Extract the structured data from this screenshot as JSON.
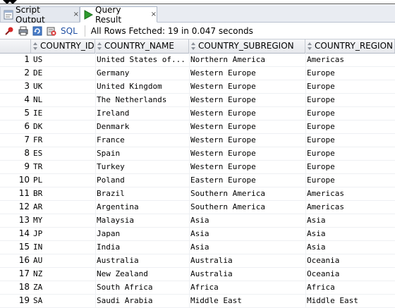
{
  "tabs": [
    {
      "label": "Script Output",
      "close": "×"
    },
    {
      "label": "Query Result",
      "close": "×"
    }
  ],
  "toolbar": {
    "icons": [
      "pin-icon",
      "print-icon",
      "refresh-icon",
      "export-icon"
    ],
    "sql_label": "SQL",
    "status": "All Rows Fetched: 19 in 0.047 seconds"
  },
  "grid": {
    "columns": [
      "COUNTRY_ID",
      "COUNTRY_NAME",
      "COUNTRY_SUBREGION",
      "COUNTRY_REGION"
    ],
    "rows": [
      {
        "n": "1",
        "id": "US",
        "name": "United States of...",
        "subregion": "Northern America",
        "region": "Americas"
      },
      {
        "n": "2",
        "id": "DE",
        "name": "Germany",
        "subregion": "Western Europe",
        "region": "Europe"
      },
      {
        "n": "3",
        "id": "UK",
        "name": "United Kingdom",
        "subregion": "Western Europe",
        "region": "Europe"
      },
      {
        "n": "4",
        "id": "NL",
        "name": "The Netherlands",
        "subregion": "Western Europe",
        "region": "Europe"
      },
      {
        "n": "5",
        "id": "IE",
        "name": "Ireland",
        "subregion": "Western Europe",
        "region": "Europe"
      },
      {
        "n": "6",
        "id": "DK",
        "name": "Denmark",
        "subregion": "Western Europe",
        "region": "Europe"
      },
      {
        "n": "7",
        "id": "FR",
        "name": "France",
        "subregion": "Western Europe",
        "region": "Europe"
      },
      {
        "n": "8",
        "id": "ES",
        "name": "Spain",
        "subregion": "Western Europe",
        "region": "Europe"
      },
      {
        "n": "9",
        "id": "TR",
        "name": "Turkey",
        "subregion": "Western Europe",
        "region": "Europe"
      },
      {
        "n": "10",
        "id": "PL",
        "name": "Poland",
        "subregion": "Eastern Europe",
        "region": "Europe"
      },
      {
        "n": "11",
        "id": "BR",
        "name": "Brazil",
        "subregion": "Southern America",
        "region": "Americas"
      },
      {
        "n": "12",
        "id": "AR",
        "name": "Argentina",
        "subregion": "Southern America",
        "region": "Americas"
      },
      {
        "n": "13",
        "id": "MY",
        "name": "Malaysia",
        "subregion": "Asia",
        "region": "Asia"
      },
      {
        "n": "14",
        "id": "JP",
        "name": "Japan",
        "subregion": "Asia",
        "region": "Asia"
      },
      {
        "n": "15",
        "id": "IN",
        "name": "India",
        "subregion": "Asia",
        "region": "Asia"
      },
      {
        "n": "16",
        "id": "AU",
        "name": "Australia",
        "subregion": "Australia",
        "region": "Oceania"
      },
      {
        "n": "17",
        "id": "NZ",
        "name": "New Zealand",
        "subregion": "Australia",
        "region": "Oceania"
      },
      {
        "n": "18",
        "id": "ZA",
        "name": "South Africa",
        "subregion": "Africa",
        "region": "Africa"
      },
      {
        "n": "19",
        "id": "SA",
        "name": "Saudi Arabia",
        "subregion": "Middle East",
        "region": "Middle East"
      }
    ]
  },
  "colors": {
    "run_icon": "#2e9b2e",
    "sql_link": "#1f4fa3",
    "pin": "#d62828"
  }
}
